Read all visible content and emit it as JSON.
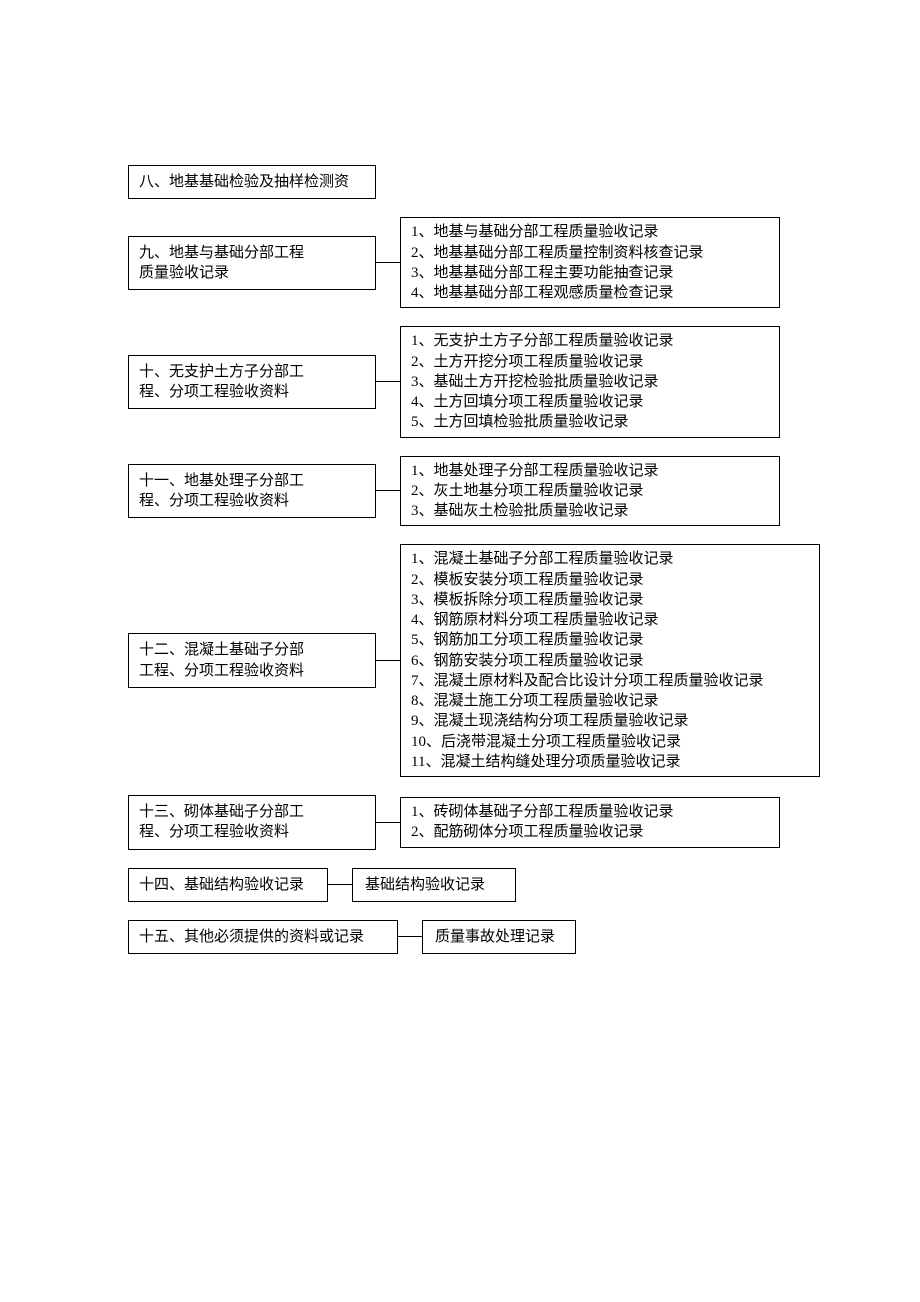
{
  "sections": {
    "s8": {
      "title": "八、地基基础检验及抽样检测资"
    },
    "s9": {
      "title_l1": "九、地基与基础分部工程",
      "title_l2": "质量验收记录",
      "items": [
        "1、地基与基础分部工程质量验收记录",
        "2、地基基础分部工程质量控制资料核查记录",
        "3、地基基础分部工程主要功能抽查记录",
        "4、地基基础分部工程观感质量检查记录"
      ]
    },
    "s10": {
      "title_l1": "十、无支护土方子分部工",
      "title_l2": "程、分项工程验收资料",
      "items": [
        "1、无支护土方子分部工程质量验收记录",
        "2、土方开挖分项工程质量验收记录",
        "3、基础土方开挖检验批质量验收记录",
        "4、土方回填分项工程质量验收记录",
        "5、土方回填检验批质量验收记录"
      ]
    },
    "s11": {
      "title_l1": "十一、地基处理子分部工",
      "title_l2": "程、分项工程验收资料",
      "items": [
        "1、地基处理子分部工程质量验收记录",
        "2、灰土地基分项工程质量验收记录",
        "3、基础灰土检验批质量验收记录"
      ]
    },
    "s12": {
      "title_l1": "十二、混凝土基础子分部",
      "title_l2": "工程、分项工程验收资料",
      "items": [
        "1、混凝土基础子分部工程质量验收记录",
        "2、模板安装分项工程质量验收记录",
        "3、模板拆除分项工程质量验收记录",
        "4、钢筋原材料分项工程质量验收记录",
        "5、钢筋加工分项工程质量验收记录",
        "6、钢筋安装分项工程质量验收记录",
        "7、混凝土原材料及配合比设计分项工程质量验收记录",
        "8、混凝土施工分项工程质量验收记录",
        "9、混凝土现浇结构分项工程质量验收记录",
        "10、后浇带混凝土分项工程质量验收记录",
        "11、混凝土结构缝处理分项质量验收记录"
      ]
    },
    "s13": {
      "title_l1": "十三、砌体基础子分部工",
      "title_l2": "程、分项工程验收资料",
      "items": [
        "1、砖砌体基础子分部工程质量验收记录",
        "2、配筋砌体分项工程质量验收记录"
      ]
    },
    "s14": {
      "title": "十四、基础结构验收记录",
      "right": "基础结构验收记录"
    },
    "s15": {
      "title": "十五、其他必须提供的资料或记录",
      "right": "质量事故处理记录"
    }
  }
}
